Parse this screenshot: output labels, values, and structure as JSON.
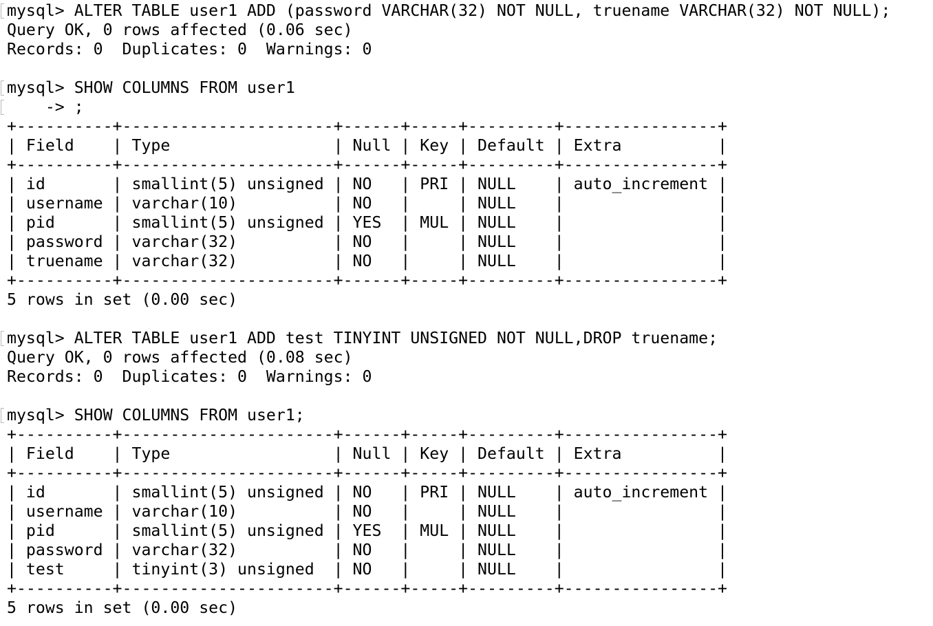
{
  "terminal": {
    "blocks": [
      {
        "prompt": "mysql> ",
        "command": "ALTER TABLE user1 ADD (password VARCHAR(32) NOT NULL, truename VARCHAR(32) NOT NULL);",
        "output": [
          "Query OK, 0 rows affected (0.06 sec)",
          "Records: 0  Duplicates: 0  Warnings: 0"
        ]
      },
      {
        "prompt": "mysql> ",
        "command": "SHOW COLUMNS FROM user1",
        "continuation": "    -> ;",
        "table": {
          "columns": [
            "Field",
            "Type",
            "Null",
            "Key",
            "Default",
            "Extra"
          ],
          "rows": [
            [
              "id",
              "smallint(5) unsigned",
              "NO",
              "PRI",
              "NULL",
              "auto_increment"
            ],
            [
              "username",
              "varchar(10)",
              "NO",
              "",
              "NULL",
              ""
            ],
            [
              "pid",
              "smallint(5) unsigned",
              "YES",
              "MUL",
              "NULL",
              ""
            ],
            [
              "password",
              "varchar(32)",
              "NO",
              "",
              "NULL",
              ""
            ],
            [
              "truename",
              "varchar(32)",
              "NO",
              "",
              "NULL",
              ""
            ]
          ],
          "footer": "5 rows in set (0.00 sec)"
        }
      },
      {
        "prompt": "mysql> ",
        "command": "ALTER TABLE user1 ADD test TINYINT UNSIGNED NOT NULL,DROP truename;",
        "output": [
          "Query OK, 0 rows affected (0.08 sec)",
          "Records: 0  Duplicates: 0  Warnings: 0"
        ]
      },
      {
        "prompt": "mysql> ",
        "command": "SHOW COLUMNS FROM user1;",
        "table": {
          "columns": [
            "Field",
            "Type",
            "Null",
            "Key",
            "Default",
            "Extra"
          ],
          "rows": [
            [
              "id",
              "smallint(5) unsigned",
              "NO",
              "PRI",
              "NULL",
              "auto_increment"
            ],
            [
              "username",
              "varchar(10)",
              "NO",
              "",
              "NULL",
              ""
            ],
            [
              "pid",
              "smallint(5) unsigned",
              "YES",
              "MUL",
              "NULL",
              ""
            ],
            [
              "password",
              "varchar(32)",
              "NO",
              "",
              "NULL",
              ""
            ],
            [
              "test",
              "tinyint(3) unsigned",
              "NO",
              "",
              "NULL",
              ""
            ]
          ],
          "footer": "5 rows in set (0.00 sec)"
        }
      }
    ]
  }
}
